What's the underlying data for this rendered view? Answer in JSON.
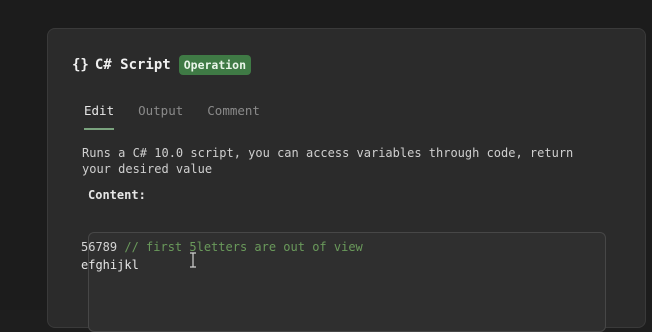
{
  "header": {
    "braces": "{}",
    "title": "C# Script",
    "badge": "Operation"
  },
  "tabs": [
    {
      "label": "Edit",
      "active": true
    },
    {
      "label": "Output",
      "active": false
    },
    {
      "label": "Comment",
      "active": false
    }
  ],
  "description": "Runs a C# 10.0 script, you can access variables through code, return your desired value",
  "content_label": "Content:",
  "editor": {
    "line1_code": "56789",
    "line1_comment": " // first 5letters are out of view",
    "line2_code": "efghijkl"
  },
  "colors": {
    "badge": "#3f7a45",
    "tab_underline": "#7aa37e",
    "comment": "#6a9a5b"
  }
}
